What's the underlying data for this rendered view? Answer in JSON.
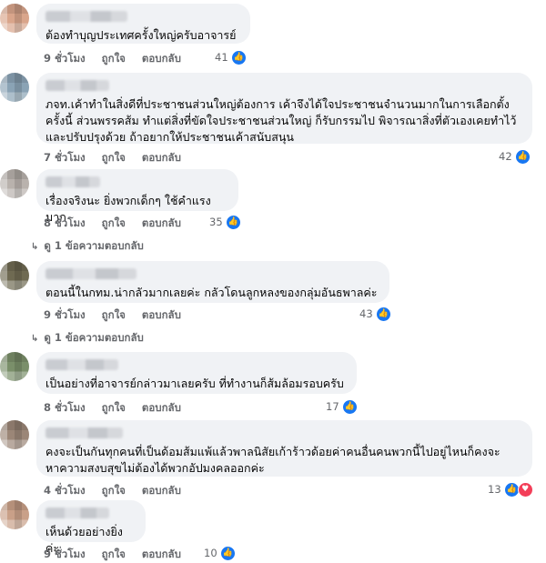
{
  "icons": {
    "like": "thumbs-up-icon",
    "love": "heart-icon",
    "reply_arrow": "reply-arrow-icon"
  },
  "colors": {
    "like": "#1877f2",
    "love": "#f33e58",
    "bubble": "#f0f2f5",
    "meta": "#65676b"
  },
  "comments": [
    {
      "text": "ต้องทำบุญประเทศครั้งใหญ่ครับอาจารย์",
      "time": "9 ชั่วโมง",
      "like_label": "ถูกใจ",
      "reply_label": "ตอบกลับ",
      "reactions": "41"
    },
    {
      "text": "ภจท.เค้าทำในสิ่งดีที่ประชาชนส่วนใหญ่ต้องการ เค้าจึงได้ใจประชาชนจำนวนมากในการเลือกตั้ง\nครั้งนี้ ส่วนพรรคส้ม ทำแต่สิ่งที่ขัดใจประชาชนส่วนใหญ่ ก็รับกรรมไป พิจารณาสิ่งที่ตัวเองเคยทำไว้\nและปรับปรุงด้วย ถ้าอยากให้ประชาชนเค้าสนับสนุน",
      "time": "7 ชั่วโมง",
      "like_label": "ถูกใจ",
      "reply_label": "ตอบกลับ",
      "reactions": "42"
    },
    {
      "text": "เรื่องจริงนะ ยิ่งพวกเด็กๆ ใช้คำแรงมาก",
      "time": "8 ชั่วโมง",
      "like_label": "ถูกใจ",
      "reply_label": "ตอบกลับ",
      "reactions": "35",
      "replies": "ดู 1 ข้อความตอบกลับ"
    },
    {
      "text": "ตอนนี้ในกทม.น่ากลัวมากเลยค่ะ กลัวโดนลูกหลงของกลุ่มอันธพาลค่ะ",
      "time": "9 ชั่วโมง",
      "like_label": "ถูกใจ",
      "reply_label": "ตอบกลับ",
      "reactions": "43",
      "replies": "ดู 1 ข้อความตอบกลับ"
    },
    {
      "text": "เป็นอย่างที่อาจารย์กล่าวมาเลยครับ ที่ทำงานก็ส้มล้อมรอบครับ",
      "time": "8 ชั่วโมง",
      "like_label": "ถูกใจ",
      "reply_label": "ตอบกลับ",
      "reactions": "17"
    },
    {
      "text": "คงจะเป็นกันทุกคนที่เป็นด้อมส้มแพ้แล้วพาลนิสัยเก้าร้าวด้อยค่าคนอื่นคนพวกนี้ไปอยู่ไหนก็คงจะ\nหาความสงบสุขไม่ต้องได้พวกอัปมงคลออกค่ะ",
      "time": "4 ชั่วโมง",
      "like_label": "ถูกใจ",
      "reply_label": "ตอบกลับ",
      "reactions": "13"
    },
    {
      "text": "เห็นด้วยอย่างยิ่งค่ะ",
      "time": "9 ชั่วโมง",
      "like_label": "ถูกใจ",
      "reply_label": "ตอบกลับ",
      "reactions": "10"
    }
  ]
}
